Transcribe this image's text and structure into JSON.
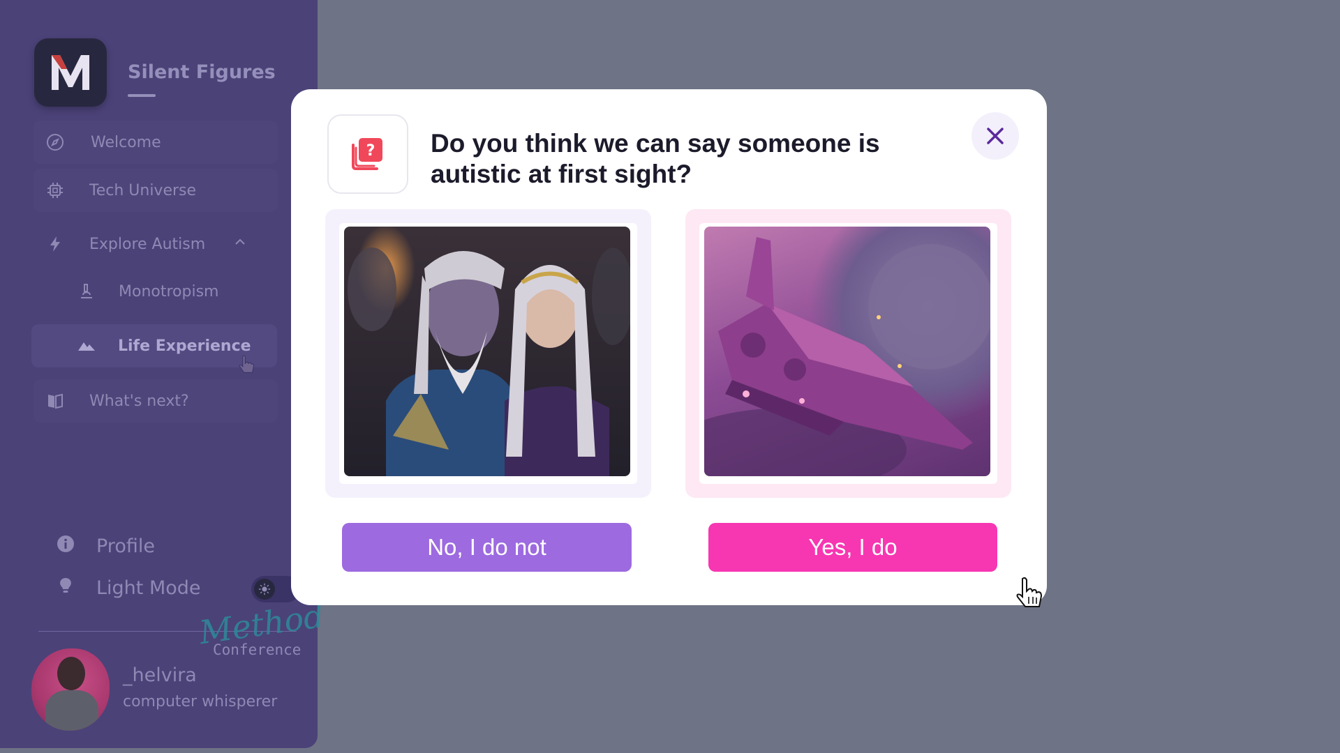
{
  "sidebar": {
    "brand": "Silent Figures",
    "logo_letter": "M",
    "nav": [
      {
        "label": "Welcome",
        "icon": "compass-icon"
      },
      {
        "label": "Tech Universe",
        "icon": "chip-icon"
      },
      {
        "label": "Explore Autism",
        "icon": "lightning-icon",
        "expanded": true
      },
      {
        "label": "Monotropism",
        "icon": "microscope-icon"
      },
      {
        "label": "Life Experience",
        "icon": "mountain-icon",
        "active": true
      },
      {
        "label": "What's next?",
        "icon": "book-icon"
      }
    ],
    "profile_label": "Profile",
    "light_mode_label": "Light Mode",
    "watermark_script": "Method",
    "watermark_word": "Conference",
    "user": {
      "name": "_helvira",
      "role": "computer whisperer"
    }
  },
  "modal": {
    "title": "Do you think we can say someone is autistic at first sight?",
    "no_label": "No, I do not",
    "yes_label": "Yes, I do",
    "colors": {
      "no_button": "#9d6ae0",
      "yes_button": "#f736b2",
      "close_icon": "#5b2a9c",
      "question_icon": "#f0485a"
    }
  },
  "theme": {
    "backdrop": "#6e7385",
    "sidebar_bg": "#4b4278"
  }
}
